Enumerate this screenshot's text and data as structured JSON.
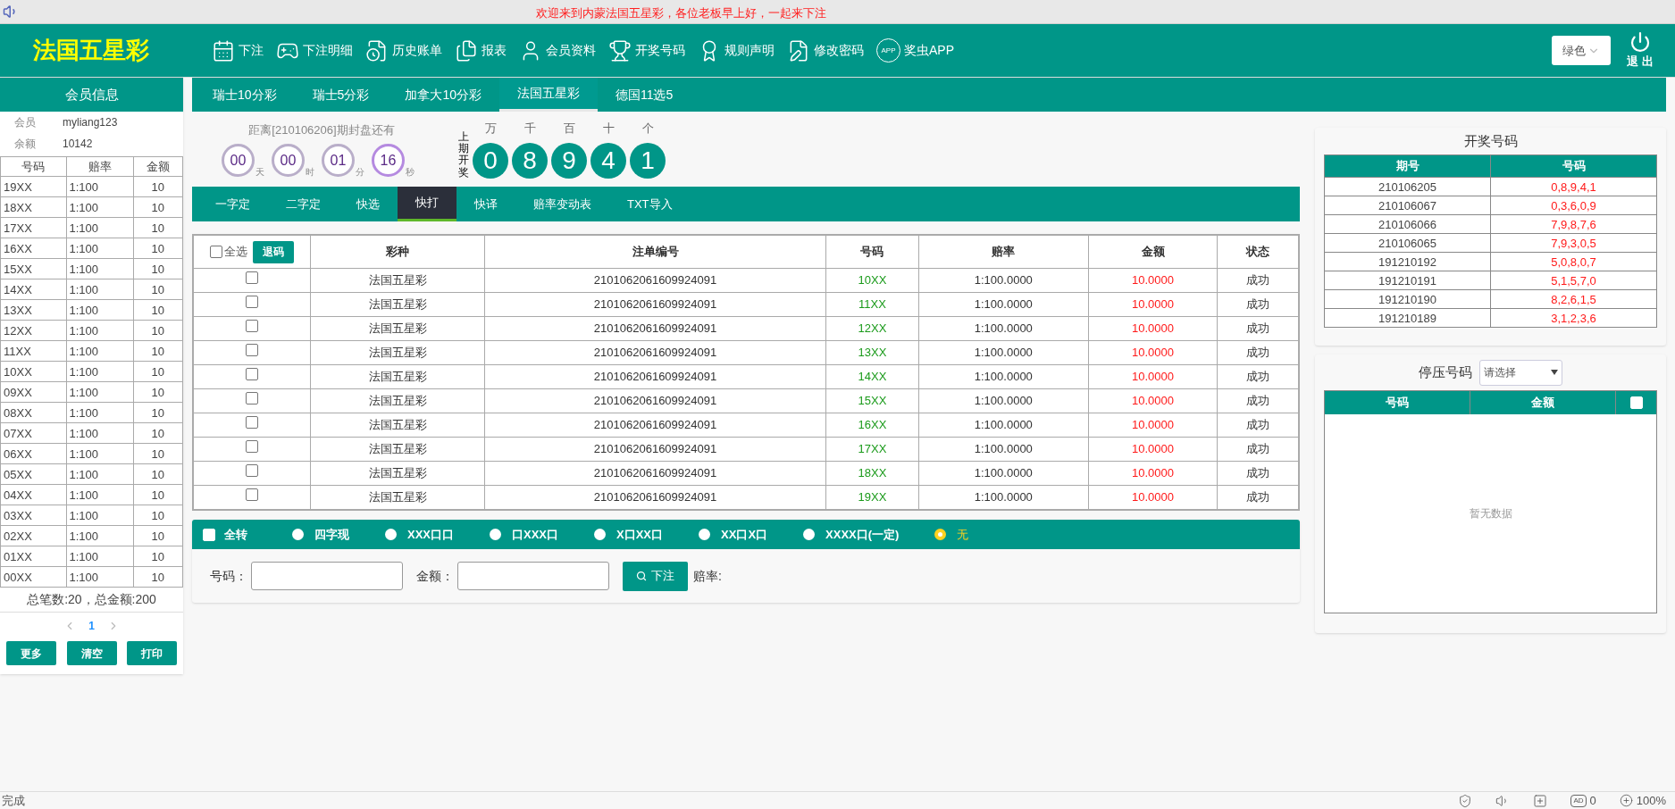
{
  "notice": "欢迎来到内蒙法国五星彩，各位老板早上好，一起来下注",
  "logo": "法国五星彩",
  "nav": [
    {
      "label": "下注"
    },
    {
      "label": "下注明细"
    },
    {
      "label": "历史账单"
    },
    {
      "label": "报表"
    },
    {
      "label": "会员资料"
    },
    {
      "label": "开奖号码"
    },
    {
      "label": "规则声明"
    },
    {
      "label": "修改密码"
    },
    {
      "label": "奖虫APP",
      "badge": "APP"
    }
  ],
  "theme_select": {
    "value": "绿色"
  },
  "logout": "退 出",
  "member": {
    "title": "会员信息",
    "fields": [
      {
        "label": "会员",
        "value": "myliang123"
      },
      {
        "label": "余额",
        "value": "10142"
      }
    ],
    "columns": [
      "号码",
      "赔率",
      "金额"
    ],
    "rows": [
      [
        "19XX",
        "1:100",
        "10"
      ],
      [
        "18XX",
        "1:100",
        "10"
      ],
      [
        "17XX",
        "1:100",
        "10"
      ],
      [
        "16XX",
        "1:100",
        "10"
      ],
      [
        "15XX",
        "1:100",
        "10"
      ],
      [
        "14XX",
        "1:100",
        "10"
      ],
      [
        "13XX",
        "1:100",
        "10"
      ],
      [
        "12XX",
        "1:100",
        "10"
      ],
      [
        "11XX",
        "1:100",
        "10"
      ],
      [
        "10XX",
        "1:100",
        "10"
      ],
      [
        "09XX",
        "1:100",
        "10"
      ],
      [
        "08XX",
        "1:100",
        "10"
      ],
      [
        "07XX",
        "1:100",
        "10"
      ],
      [
        "06XX",
        "1:100",
        "10"
      ],
      [
        "05XX",
        "1:100",
        "10"
      ],
      [
        "04XX",
        "1:100",
        "10"
      ],
      [
        "03XX",
        "1:100",
        "10"
      ],
      [
        "02XX",
        "1:100",
        "10"
      ],
      [
        "01XX",
        "1:100",
        "10"
      ],
      [
        "00XX",
        "1:100",
        "10"
      ]
    ],
    "summary": "总笔数:20，总金额:200",
    "pages": [
      {
        "label": "1",
        "selected": true
      }
    ],
    "buttons": [
      "更多",
      "清空",
      "打印"
    ]
  },
  "game_tabs": [
    {
      "label": "瑞士10分彩",
      "selected": false
    },
    {
      "label": "瑞士5分彩",
      "selected": false
    },
    {
      "label": "加拿大10分彩",
      "selected": false
    },
    {
      "label": "法国五星彩",
      "selected": true
    },
    {
      "label": "德国11选5",
      "selected": false
    }
  ],
  "countdown": {
    "caption": "距离[210106206]期封盘还有",
    "units": [
      {
        "value": "00",
        "unit": "天"
      },
      {
        "value": "00",
        "unit": "时"
      },
      {
        "value": "01",
        "unit": "分"
      },
      {
        "value": "16",
        "unit": "秒"
      }
    ]
  },
  "last_draw": {
    "label": "上期开奖",
    "positions": [
      "万",
      "千",
      "百",
      "十",
      "个"
    ],
    "balls": [
      "0",
      "8",
      "9",
      "4",
      "1"
    ]
  },
  "play_tabs": [
    {
      "label": "一字定",
      "selected": false
    },
    {
      "label": "二字定",
      "selected": false
    },
    {
      "label": "快选",
      "selected": false
    },
    {
      "label": "快打",
      "selected": true
    },
    {
      "label": "快译",
      "selected": false
    },
    {
      "label": "赔率变动表",
      "selected": false
    },
    {
      "label": "TXT导入",
      "selected": false
    }
  ],
  "bets": {
    "select_all": {
      "label": "全选",
      "checked": false
    },
    "refund_button": "退码",
    "columns": [
      "彩种",
      "注单编号",
      "号码",
      "赔率",
      "金额",
      "状态"
    ],
    "rows": [
      {
        "checked": false,
        "game": "法国五星彩",
        "order": "2101062061609924091",
        "number": "10XX",
        "odds": "1:100.0000",
        "amount": "10.0000",
        "status": "成功"
      },
      {
        "checked": false,
        "game": "法国五星彩",
        "order": "2101062061609924091",
        "number": "11XX",
        "odds": "1:100.0000",
        "amount": "10.0000",
        "status": "成功"
      },
      {
        "checked": false,
        "game": "法国五星彩",
        "order": "2101062061609924091",
        "number": "12XX",
        "odds": "1:100.0000",
        "amount": "10.0000",
        "status": "成功"
      },
      {
        "checked": false,
        "game": "法国五星彩",
        "order": "2101062061609924091",
        "number": "13XX",
        "odds": "1:100.0000",
        "amount": "10.0000",
        "status": "成功"
      },
      {
        "checked": false,
        "game": "法国五星彩",
        "order": "2101062061609924091",
        "number": "14XX",
        "odds": "1:100.0000",
        "amount": "10.0000",
        "status": "成功"
      },
      {
        "checked": false,
        "game": "法国五星彩",
        "order": "2101062061609924091",
        "number": "15XX",
        "odds": "1:100.0000",
        "amount": "10.0000",
        "status": "成功"
      },
      {
        "checked": false,
        "game": "法国五星彩",
        "order": "2101062061609924091",
        "number": "16XX",
        "odds": "1:100.0000",
        "amount": "10.0000",
        "status": "成功"
      },
      {
        "checked": false,
        "game": "法国五星彩",
        "order": "2101062061609924091",
        "number": "17XX",
        "odds": "1:100.0000",
        "amount": "10.0000",
        "status": "成功"
      },
      {
        "checked": false,
        "game": "法国五星彩",
        "order": "2101062061609924091",
        "number": "18XX",
        "odds": "1:100.0000",
        "amount": "10.0000",
        "status": "成功"
      },
      {
        "checked": false,
        "game": "法国五星彩",
        "order": "2101062061609924091",
        "number": "19XX",
        "odds": "1:100.0000",
        "amount": "10.0000",
        "status": "成功"
      }
    ]
  },
  "options": {
    "all_turn": {
      "label": "全转",
      "checked": false
    },
    "radios": [
      {
        "label": "四字现",
        "selected": false
      },
      {
        "label": "XXX口口",
        "selected": false
      },
      {
        "label": "口XXX口",
        "selected": false
      },
      {
        "label": "X口XX口",
        "selected": false
      },
      {
        "label": "XX口X口",
        "selected": false
      },
      {
        "label": "XXXX口(一定)",
        "selected": false
      },
      {
        "label": "无",
        "selected": true
      }
    ]
  },
  "form": {
    "number_label": "号码：",
    "amount_label": "金额：",
    "submit": "下注",
    "odds_label": "赔率:"
  },
  "draw_results": {
    "title": "开奖号码",
    "columns": [
      "期号",
      "号码"
    ],
    "rows": [
      {
        "period": "210106205",
        "numbers": "0,8,9,4,1"
      },
      {
        "period": "210106067",
        "numbers": "0,3,6,0,9"
      },
      {
        "period": "210106066",
        "numbers": "7,9,8,7,6"
      },
      {
        "period": "210106065",
        "numbers": "7,9,3,0,5"
      },
      {
        "period": "191210192",
        "numbers": "5,0,8,0,7"
      },
      {
        "period": "191210191",
        "numbers": "5,1,5,7,0"
      },
      {
        "period": "191210190",
        "numbers": "8,2,6,1,5"
      },
      {
        "period": "191210189",
        "numbers": "3,1,2,3,6"
      }
    ]
  },
  "stop": {
    "label": "停压号码",
    "select_placeholder": "请选择",
    "columns": [
      "号码",
      "金额"
    ],
    "header_checkbox": {
      "checked": false
    },
    "empty": "暂无数据"
  },
  "status_bar": {
    "text": "完成",
    "ad_badge": "AD",
    "ad_count": "0",
    "zoom": "100%"
  }
}
